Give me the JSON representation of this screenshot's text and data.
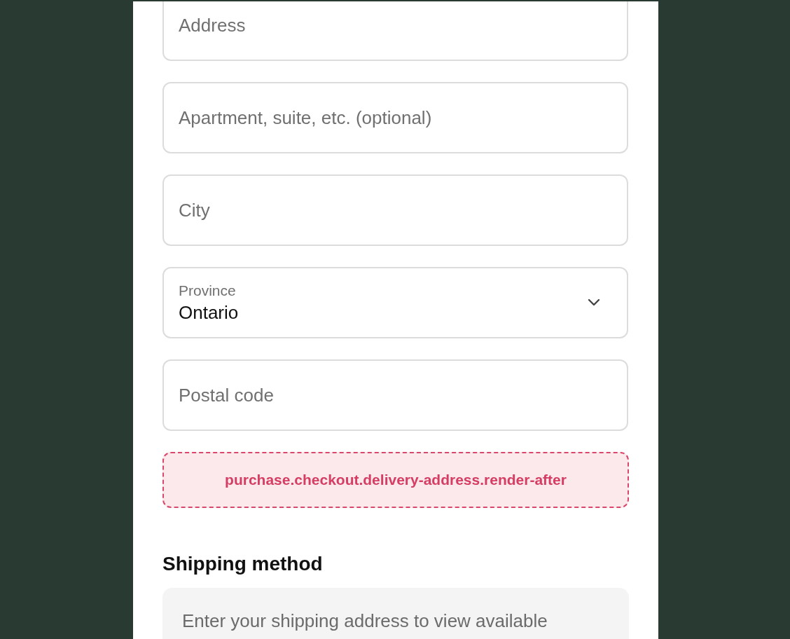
{
  "fields": [
    {
      "kind": "text",
      "placeholder": "Address"
    },
    {
      "kind": "text",
      "placeholder": "Apartment, suite, etc. (optional)"
    },
    {
      "kind": "text",
      "placeholder": "City"
    },
    {
      "kind": "select",
      "label": "Province",
      "value": "Ontario"
    },
    {
      "kind": "text",
      "placeholder": "Postal code"
    }
  ],
  "extension_notice": "purchase.checkout.delivery-address.render-after",
  "shipping_method": {
    "heading": "Shipping method",
    "notice": "Enter your shipping address to view available"
  }
}
